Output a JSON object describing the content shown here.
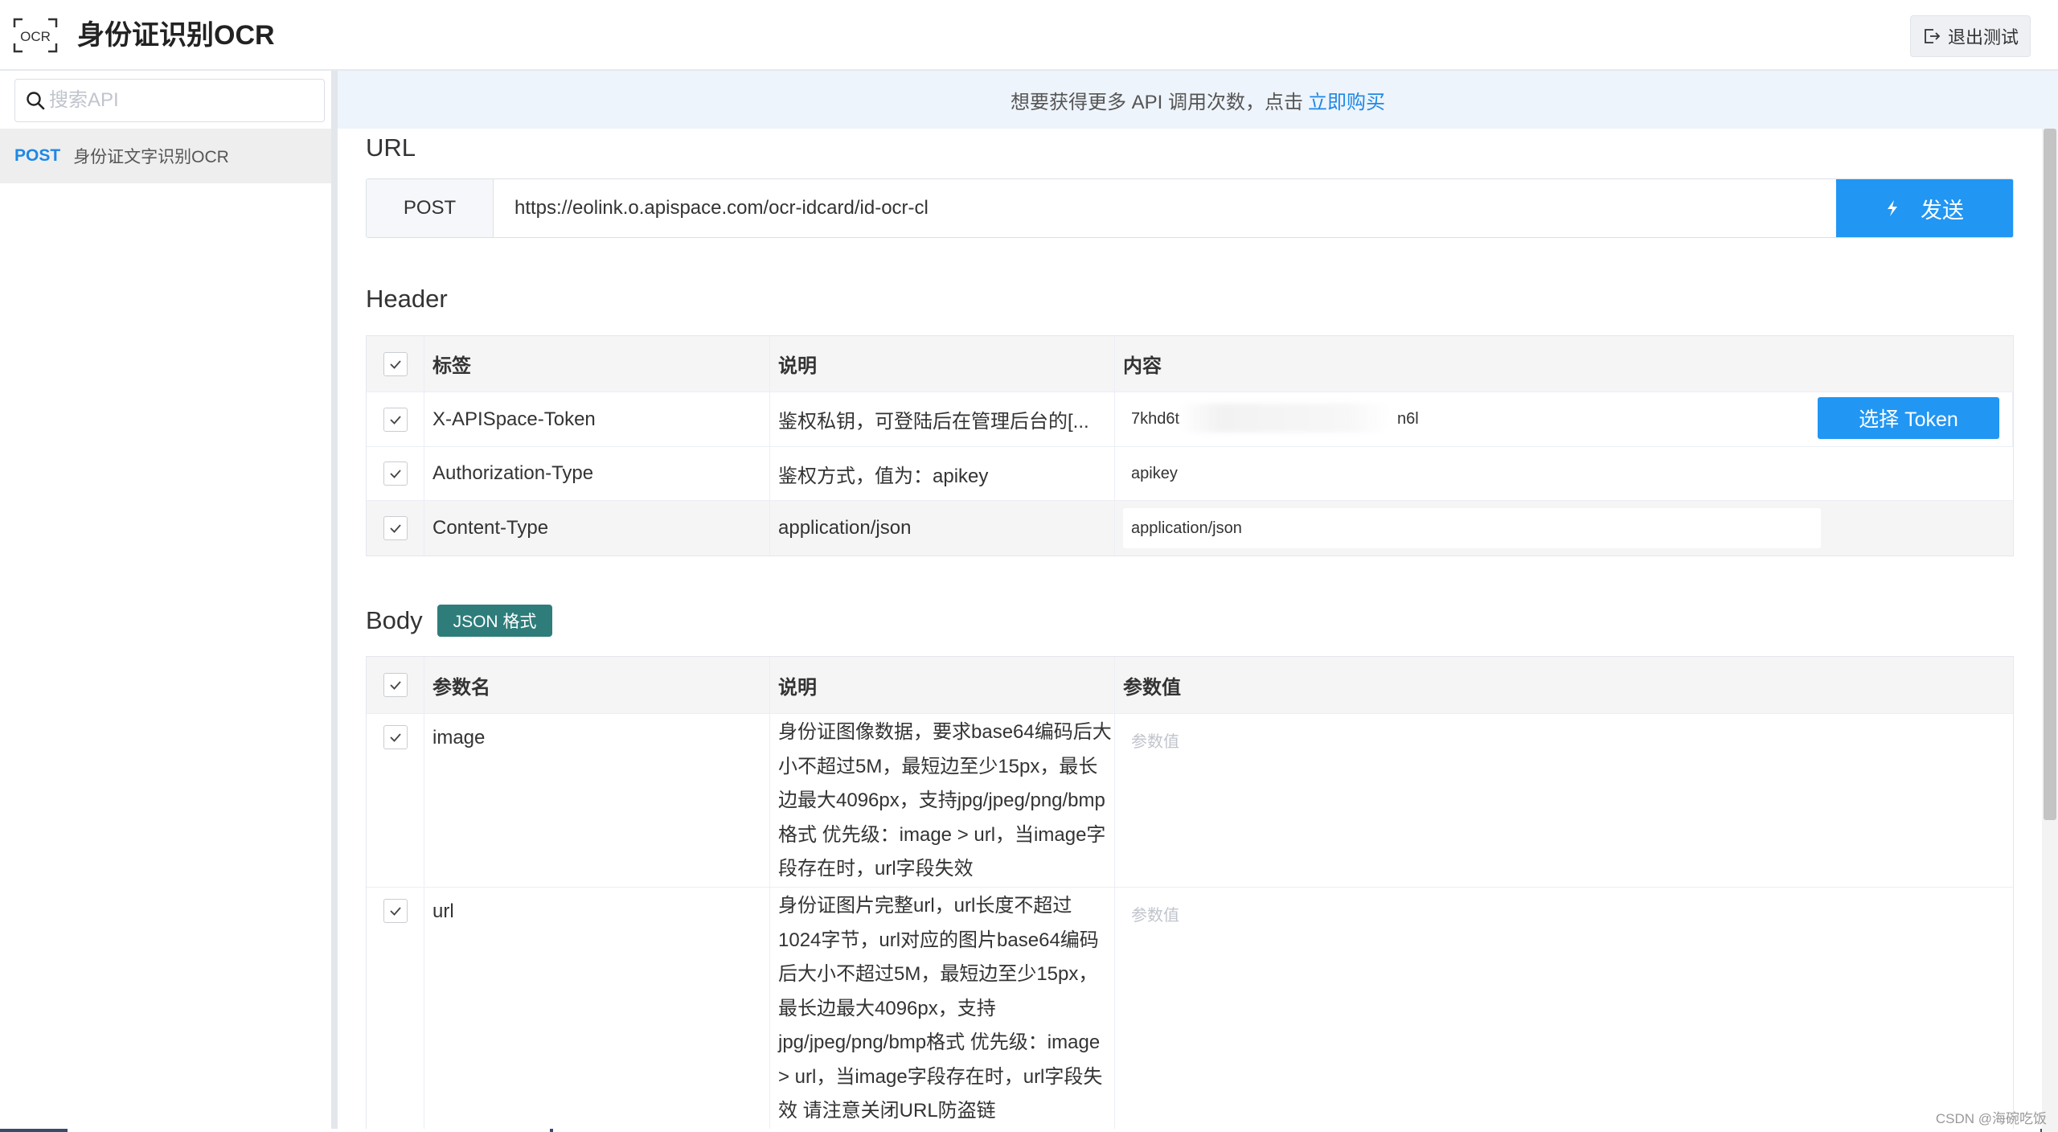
{
  "app": {
    "title": "身份证识别OCR",
    "logo_text": "OCR",
    "exit_label": "退出测试"
  },
  "sidebar": {
    "search_placeholder": "搜索API",
    "items": [
      {
        "method": "POST",
        "name": "身份证文字识别OCR"
      }
    ]
  },
  "notice": {
    "text": "想要获得更多 API 调用次数，点击",
    "link": "立即购买"
  },
  "url_section": {
    "title": "URL",
    "method": "POST",
    "url": "https://eolink.o.apispace.com/ocr-idcard/id-ocr-cl",
    "send_label": "发送"
  },
  "header_section": {
    "title": "Header",
    "columns": [
      "标签",
      "说明",
      "内容"
    ],
    "rows": [
      {
        "key": "X-APISpace-Token",
        "desc": "鉴权私钥，可登陆后在管理后台的[...",
        "value_start": "7khd6t",
        "value_end": "n6l",
        "button": "选择 Token"
      },
      {
        "key": "Authorization-Type",
        "desc": "鉴权方式，值为：apikey",
        "value": "apikey"
      },
      {
        "key": "Content-Type",
        "desc": "application/json",
        "value": "application/json"
      }
    ]
  },
  "body_section": {
    "title": "Body",
    "badge": "JSON 格式",
    "columns": [
      "参数名",
      "说明",
      "参数值"
    ],
    "rows": [
      {
        "key": "image",
        "desc": "身份证图像数据，要求base64编码后大小不超过5M，最短边至少15px，最长边最大4096px，支持jpg/jpeg/png/bmp格式 优先级：image > url，当image字段存在时，url字段失效",
        "placeholder": "参数值"
      },
      {
        "key": "url",
        "desc": "身份证图片完整url，url长度不超过1024字节，url对应的图片base64编码后大小不超过5M，最短边至少15px，最长边最大4096px，支持jpg/jpeg/png/bmp格式 优先级：image > url，当image字段存在时，url字段失效 请注意关闭URL防盗链",
        "placeholder": "参数值"
      }
    ]
  },
  "watermark": "CSDN @海碗吃饭",
  "colors": {
    "accent": "#2196f3",
    "badge": "#2e7d7b",
    "notice_bg": "#eef4fb"
  }
}
